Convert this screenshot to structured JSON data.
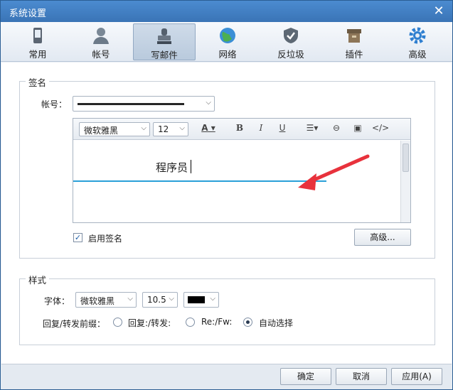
{
  "window": {
    "title": "系统设置"
  },
  "toolbar": [
    {
      "label": "常用",
      "icon": "phone-icon"
    },
    {
      "label": "帐号",
      "icon": "user-icon"
    },
    {
      "label": "写邮件",
      "icon": "stamp-icon"
    },
    {
      "label": "网络",
      "icon": "globe-icon"
    },
    {
      "label": "反垃圾",
      "icon": "shield-icon"
    },
    {
      "label": "插件",
      "icon": "box-icon"
    },
    {
      "label": "高级",
      "icon": "gear-icon"
    }
  ],
  "toolbar_active": "写邮件",
  "signature": {
    "legend": "签名",
    "account_label": "帐号：",
    "editor": {
      "font": "微软雅黑",
      "size": "12",
      "color_btn": "A",
      "bold": "B",
      "italic": "I",
      "underline": "U",
      "content_text": "程序员"
    },
    "enable_label": "启用签名",
    "enable_checked": true,
    "advanced_button": "高级..."
  },
  "style": {
    "legend": "样式",
    "font_label": "字体：",
    "font_value": "微软雅黑",
    "size_value": "10.5",
    "color_value": "#000000",
    "prefix_label": "回复/转发前缀：",
    "options": [
      {
        "label": "回复:/转发:",
        "checked": false
      },
      {
        "label": "Re:/Fw:",
        "checked": false
      },
      {
        "label": "自动选择",
        "checked": true
      }
    ]
  },
  "footer": {
    "ok": "确定",
    "cancel": "取消",
    "apply": "应用(A)"
  },
  "colors": {
    "accent": "#3a74b6",
    "underline": "#2aa0d8",
    "arrow": "#e8323c"
  }
}
